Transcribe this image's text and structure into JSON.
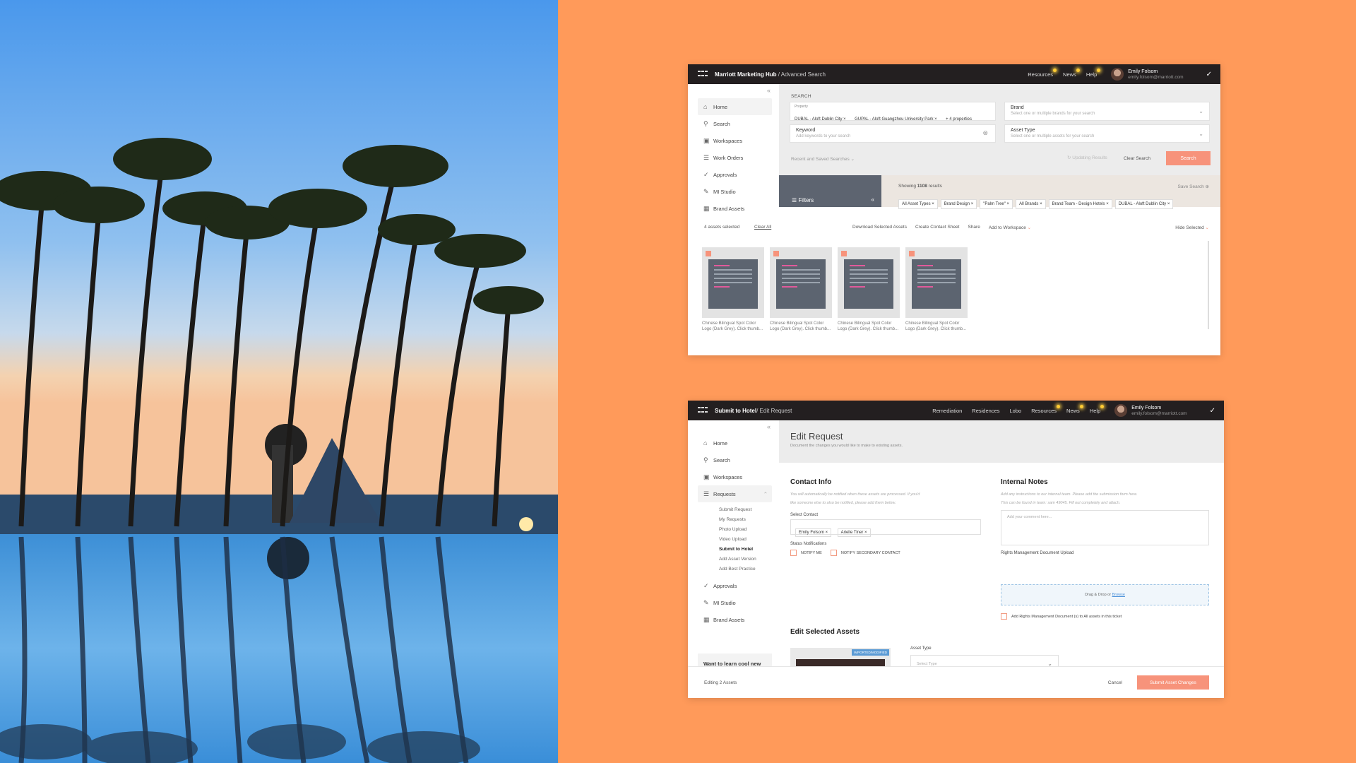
{
  "colors": {
    "background": "#ff9a5a",
    "accent": "#f7937b",
    "topbar": "#231f20",
    "filters": "#5d6470"
  },
  "window1": {
    "crumb_app": "Marriott Marketing Hub",
    "crumb_page": "/ Advanced Search",
    "nav": [
      "Resources",
      "News",
      "Help"
    ],
    "user": {
      "name": "Emily Folsom",
      "email": "emily.folsom@marriott.com"
    },
    "sidebar": [
      {
        "label": "Home",
        "icon": "home-icon"
      },
      {
        "label": "Search",
        "icon": "search-icon"
      },
      {
        "label": "Workspaces",
        "icon": "workspace-icon"
      },
      {
        "label": "Work Orders",
        "icon": "list-icon"
      },
      {
        "label": "Approvals",
        "icon": "check-icon"
      },
      {
        "label": "MI Studio",
        "icon": "edit-icon"
      },
      {
        "label": "Brand Assets",
        "icon": "building-icon"
      }
    ],
    "search": {
      "heading": "SEARCH",
      "property_label": "Property",
      "property_chips": [
        "DUBAL - Aloft Dublin City",
        "GUPAL - Aloft Guangzhou University Park",
        "+ 4 properties"
      ],
      "brand_label": "Brand",
      "brand_placeholder": "Select one or multiple brands for your search",
      "keyword_label": "Keyword",
      "keyword_placeholder": "Add keywords to your search",
      "asset_type_label": "Asset Type",
      "asset_type_placeholder": "Select one or multiple assets for your search",
      "recent": "Recent and Saved Searches",
      "updating": "Updating Results",
      "clear": "Clear Search",
      "search_button": "Search"
    },
    "results": {
      "filters": "Filters",
      "showing": "Showing",
      "count": "1108",
      "results": "results",
      "save_search": "Save Search",
      "tags": [
        "All Asset Types",
        "Brand Design",
        "\"Palm Tree\"",
        "All Brands",
        "Brand Team - Design Hotels",
        "DUBAL - Aloft Dublin City"
      ]
    },
    "selection": {
      "count_text": "4 assets selected",
      "clear_all": "Clear All",
      "download": "Download Selected Assets",
      "contact_sheet": "Create Contact Sheet",
      "share": "Share",
      "add_ws": "Add to Workspace",
      "hide": "Hide Selected"
    },
    "assets": [
      {
        "caption": "Chinese Bilingual Spot Color Logo (Dark Grey). Click thumb..."
      },
      {
        "caption": "Chinese Bilingual Spot Color Logo (Dark Grey). Click thumb..."
      },
      {
        "caption": "Chinese Bilingual Spot Color Logo (Dark Grey). Click thumb..."
      },
      {
        "caption": "Chinese Bilingual Spot Color Logo (Dark Grey). Click thumb..."
      }
    ]
  },
  "window2": {
    "crumb_app": "Submit to Hotel",
    "crumb_page": "/ Edit Request",
    "nav": [
      "Remediation",
      "Residences",
      "Lobo",
      "Resources",
      "News",
      "Help"
    ],
    "user": {
      "name": "Emily Folsom",
      "email": "emily.folsom@marriott.com"
    },
    "sidebar": [
      {
        "label": "Home",
        "icon": "home-icon"
      },
      {
        "label": "Search",
        "icon": "search-icon"
      },
      {
        "label": "Workspaces",
        "icon": "workspace-icon"
      },
      {
        "label": "Requests",
        "icon": "list-icon"
      }
    ],
    "subitems": [
      "Submit Request",
      "My Requests",
      "Photo Upload",
      "Video Upload",
      "Submit to Hotel",
      "Add Asset Version",
      "Add Best Practice"
    ],
    "sidebar_bottom": [
      {
        "label": "Approvals",
        "icon": "check-icon"
      },
      {
        "label": "MI Studio",
        "icon": "edit-icon"
      },
      {
        "label": "Brand Assets",
        "icon": "building-icon"
      }
    ],
    "tips": "Want to learn cool new tips and tricks?",
    "title": "Edit Request",
    "subtitle": "Document the changes you would like to make to existing assets.",
    "contact": {
      "heading": "Contact Info",
      "note1": "You will automatically be notified when these assets are processed. If you'd",
      "note2": "like someone else to also be notified, please add them below.",
      "select_label": "Select Contact",
      "contacts": [
        "Emily Folsom",
        "Arielle Tiner"
      ],
      "status_label": "Status Notifications",
      "notify_me": "NOTIFY ME",
      "notify_secondary": "NOTIFY SECONDARY CONTACT"
    },
    "internal": {
      "heading": "Internal Notes",
      "note1": "Add any instructions to our internal team. Please add the submission form here.",
      "note2": "This can be found in team: sam 49045. Fill out completely and attach.",
      "placeholder": "Add your comment here...",
      "upload_label": "Rights Management Document Upload",
      "drag": "Drag & Drop or",
      "browse": "Browse",
      "apply_all": "Add Rights Management Document (s) to All assets in this ticket"
    },
    "edit_assets": {
      "heading": "Edit Selected Assets",
      "badge": "IMPORTED/MODIFIED",
      "asset_type_label": "Asset Type",
      "select_type": "Select Type"
    },
    "footer": {
      "editing": "Editing 2 Assets",
      "cancel": "Cancel",
      "submit": "Submit Asset Changes"
    }
  }
}
